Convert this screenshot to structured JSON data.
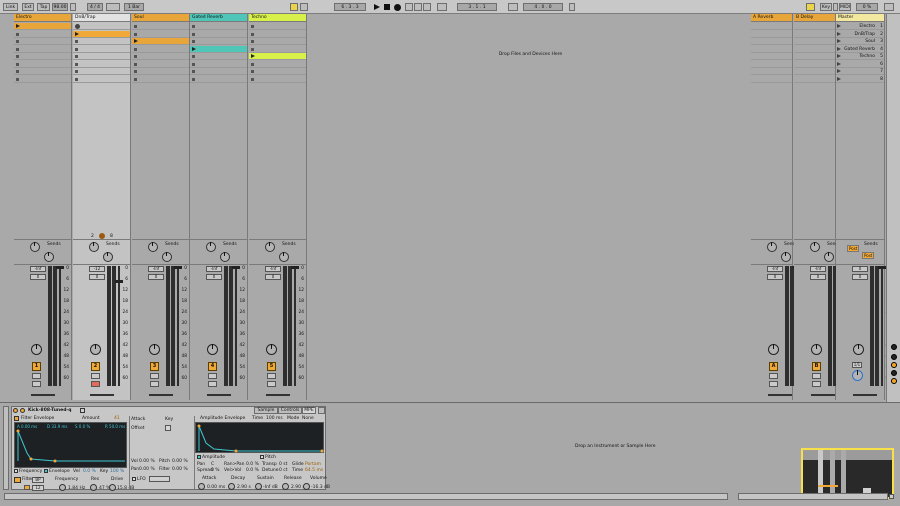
{
  "transport": {
    "link": "Link",
    "ext": "Ext",
    "tap": "Tap",
    "tempo": "98.00",
    "signature": "4 / 4",
    "quantize": "1 Bar",
    "position": "6 . 3 . 3",
    "loop_start": "3 . 1 . 1",
    "loop_length": "4 . 0 . 0",
    "key": "Key",
    "midi": "MIDI",
    "cpu": "0 %"
  },
  "tracks": [
    {
      "name": "Electro",
      "color": "#e8a63a",
      "number": "1",
      "vol": "-Inf",
      "pan": "0"
    },
    {
      "name": "DnB/Trap",
      "color": "#e2e2e2",
      "number": "2",
      "vol": "-12",
      "pan": "0"
    },
    {
      "name": "Soul",
      "color": "#e8a63a",
      "number": "3",
      "vol": "-Inf",
      "pan": "0"
    },
    {
      "name": "Gated Reverb",
      "color": "#4fc6b8",
      "number": "4",
      "vol": "-Inf",
      "pan": "0"
    },
    {
      "name": "Techno",
      "color": "#d7f04a",
      "number": "5",
      "vol": "-Inf",
      "pan": "0"
    }
  ],
  "return_tracks": [
    {
      "name": "A Reverb",
      "color": "#e8a63a",
      "letter": "A",
      "vol": "-Inf",
      "pan": "0"
    },
    {
      "name": "B Delay",
      "color": "#e8a63a",
      "letter": "B",
      "vol": "-Inf",
      "pan": "0"
    }
  ],
  "master": {
    "name": "Master",
    "vol": "0",
    "pan": "0",
    "scenes": [
      "Electro",
      "DnB/Trap",
      "Soul",
      "Gated Reverb",
      "Techno",
      "",
      "",
      ""
    ],
    "scene_numbers": [
      "1",
      "2",
      "3",
      "4",
      "5",
      "6",
      "7",
      "8"
    ],
    "post1": "Post",
    "post2": "Post",
    "cue": "1/1"
  },
  "sends_label": "Sends",
  "scale": [
    "0",
    "6",
    "12",
    "18",
    "24",
    "30",
    "36",
    "42",
    "48",
    "54",
    "60"
  ],
  "drop_files": "Drop Files and Devices Here",
  "drop_instrument": "Drop an Instrument or Sample Here",
  "dnb_footer": {
    "a": "2",
    "b": "8"
  },
  "device": {
    "name": "Kick-808-Tuned-q",
    "filter_env": "Filter Envelope",
    "amount_label": "Amount",
    "amount": "41",
    "a": "A 0.00 ms",
    "d": "D 33.9 ms",
    "s": "S 0.0 %",
    "r": "R 50.0 ms",
    "frequency_label": "Frequency",
    "envelope_label": "Envelope",
    "vel_label": "Vel",
    "vel": "0.0 %",
    "key_label": "Key",
    "key": "100 %",
    "filter_label": "Filter",
    "filter_type": "BP",
    "filter_slope": "12",
    "freq_label": "Frequency",
    "freq_val": "1.84 Hz",
    "res_label": "Res",
    "res_val": "47 %",
    "drive_label": "Drive",
    "drive_val": "15.8 dB",
    "attack_label": "Attack",
    "key2_label": "Key",
    "offset_label": "Offset",
    "vol_label": "Vol",
    "vol_val": "0.00 %",
    "pitch_label": "Pitch",
    "pitch_val": "0.00 %",
    "pan_label": "Pan",
    "pan_val": "0.00 %",
    "filter2_label": "Filter",
    "filter2_val": "0.00 %",
    "lfo": "LFO",
    "amp_env": "Amplitude Envelope",
    "time_label": "Time",
    "time_val": "100 ms",
    "mode_label": "Mode",
    "mode_val": "None",
    "amplitude": "Amplitude",
    "pitch_tab": "Pitch",
    "pan2_label": "Pan",
    "pan2_val": "C",
    "ranpan_label": "Ran>Pan",
    "ranpan_val": "0.0 %",
    "transp_label": "Transp",
    "transp_val": "0 st",
    "glide_label": "Glide",
    "glide_val": "Portam",
    "spread_label": "Spread",
    "spread_val": "0 %",
    "velvol_label": "Vel>Vol",
    "velvol_val": "0.0 %",
    "detune_label": "Detune",
    "detune_val": "0 ct",
    "time2_label": "Time",
    "time2_val": "64.5 ms",
    "attack2_label": "Attack",
    "attack2_val": "0.00 ms",
    "decay_label": "Decay",
    "decay_val": "2.90 s",
    "sustain_label": "Sustain",
    "sustain_val": "-Inf dB",
    "release_label": "Release",
    "release_val": "2.90 s",
    "volume_label": "Volume",
    "volume_val": "-16.3 dB",
    "tab_sample": "Sample",
    "tab_controls": "Controls",
    "tab_mpe": "MPE"
  }
}
